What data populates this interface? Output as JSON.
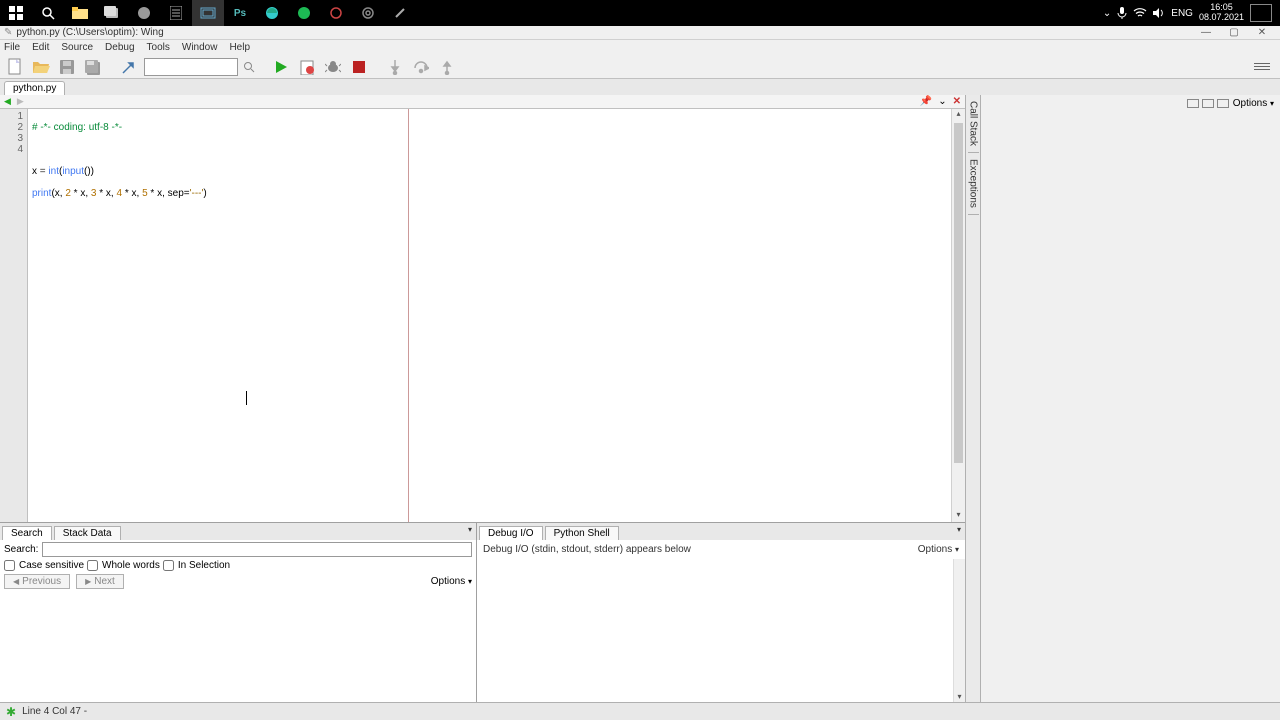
{
  "taskbar": {
    "time": "16:05",
    "date": "08.07.2021",
    "lang": "ENG"
  },
  "window": {
    "title": "python.py (C:\\Users\\optim): Wing"
  },
  "menu": {
    "file": "File",
    "edit": "Edit",
    "source": "Source",
    "debug": "Debug",
    "tools": "Tools",
    "window": "Window",
    "help": "Help"
  },
  "tabs": {
    "file": "python.py"
  },
  "right_panel": {
    "options": "Options",
    "call_stack": "Call Stack",
    "exceptions": "Exceptions"
  },
  "code": {
    "lines": [
      "1",
      "2",
      "3",
      "4"
    ],
    "l1": "# -*- coding: utf-8 -*-",
    "l3_var": "x ",
    "l3_eq": "= ",
    "l3_int": "int",
    "l3_paren1": "(",
    "l3_input": "input",
    "l3_paren2": "())",
    "l4_print": "print",
    "l4_p1": "(x, ",
    "l4_n2": "2",
    "l4_mx": " * x, ",
    "l4_n3": "3",
    "l4_n4": "4",
    "l4_n5": "5",
    "l4_sep": " * x, sep=",
    "l4_str": "'---'",
    "l4_end": ")"
  },
  "bottom_left": {
    "tab_search": "Search",
    "tab_stack": "Stack Data",
    "search_label": "Search:",
    "case": "Case sensitive",
    "whole": "Whole words",
    "insel": "In Selection",
    "prev": "Previous",
    "next": "Next",
    "options": "Options"
  },
  "bottom_right": {
    "tab_debug": "Debug I/O",
    "tab_shell": "Python Shell",
    "msg": "Debug I/O (stdin, stdout, stderr) appears below",
    "options": "Options"
  },
  "status": {
    "pos": "Line 4 Col 47 -"
  }
}
